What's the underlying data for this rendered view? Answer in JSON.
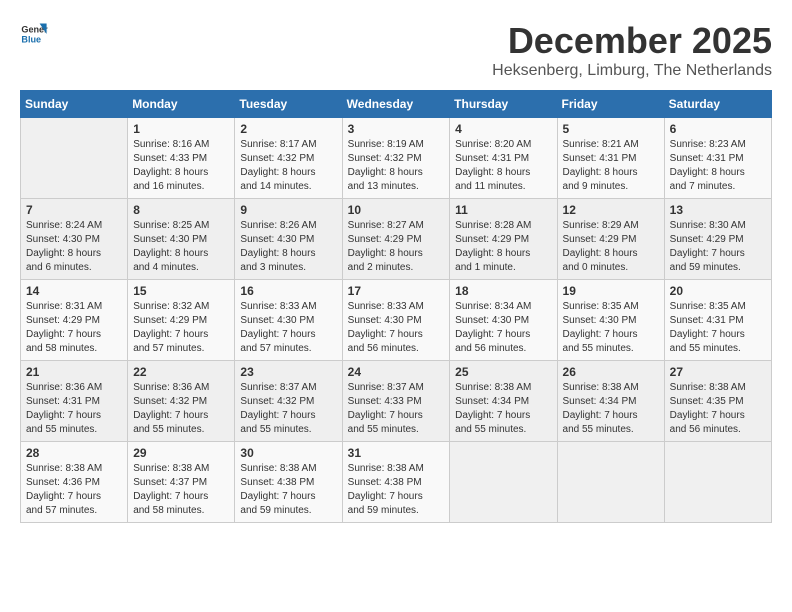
{
  "logo": {
    "line1": "General",
    "line2": "Blue"
  },
  "title": "December 2025",
  "location": "Heksenberg, Limburg, The Netherlands",
  "headers": [
    "Sunday",
    "Monday",
    "Tuesday",
    "Wednesday",
    "Thursday",
    "Friday",
    "Saturday"
  ],
  "weeks": [
    [
      {
        "day": "",
        "info": ""
      },
      {
        "day": "1",
        "info": "Sunrise: 8:16 AM\nSunset: 4:33 PM\nDaylight: 8 hours\nand 16 minutes."
      },
      {
        "day": "2",
        "info": "Sunrise: 8:17 AM\nSunset: 4:32 PM\nDaylight: 8 hours\nand 14 minutes."
      },
      {
        "day": "3",
        "info": "Sunrise: 8:19 AM\nSunset: 4:32 PM\nDaylight: 8 hours\nand 13 minutes."
      },
      {
        "day": "4",
        "info": "Sunrise: 8:20 AM\nSunset: 4:31 PM\nDaylight: 8 hours\nand 11 minutes."
      },
      {
        "day": "5",
        "info": "Sunrise: 8:21 AM\nSunset: 4:31 PM\nDaylight: 8 hours\nand 9 minutes."
      },
      {
        "day": "6",
        "info": "Sunrise: 8:23 AM\nSunset: 4:31 PM\nDaylight: 8 hours\nand 7 minutes."
      }
    ],
    [
      {
        "day": "7",
        "info": "Sunrise: 8:24 AM\nSunset: 4:30 PM\nDaylight: 8 hours\nand 6 minutes."
      },
      {
        "day": "8",
        "info": "Sunrise: 8:25 AM\nSunset: 4:30 PM\nDaylight: 8 hours\nand 4 minutes."
      },
      {
        "day": "9",
        "info": "Sunrise: 8:26 AM\nSunset: 4:30 PM\nDaylight: 8 hours\nand 3 minutes."
      },
      {
        "day": "10",
        "info": "Sunrise: 8:27 AM\nSunset: 4:29 PM\nDaylight: 8 hours\nand 2 minutes."
      },
      {
        "day": "11",
        "info": "Sunrise: 8:28 AM\nSunset: 4:29 PM\nDaylight: 8 hours\nand 1 minute."
      },
      {
        "day": "12",
        "info": "Sunrise: 8:29 AM\nSunset: 4:29 PM\nDaylight: 8 hours\nand 0 minutes."
      },
      {
        "day": "13",
        "info": "Sunrise: 8:30 AM\nSunset: 4:29 PM\nDaylight: 7 hours\nand 59 minutes."
      }
    ],
    [
      {
        "day": "14",
        "info": "Sunrise: 8:31 AM\nSunset: 4:29 PM\nDaylight: 7 hours\nand 58 minutes."
      },
      {
        "day": "15",
        "info": "Sunrise: 8:32 AM\nSunset: 4:29 PM\nDaylight: 7 hours\nand 57 minutes."
      },
      {
        "day": "16",
        "info": "Sunrise: 8:33 AM\nSunset: 4:30 PM\nDaylight: 7 hours\nand 57 minutes."
      },
      {
        "day": "17",
        "info": "Sunrise: 8:33 AM\nSunset: 4:30 PM\nDaylight: 7 hours\nand 56 minutes."
      },
      {
        "day": "18",
        "info": "Sunrise: 8:34 AM\nSunset: 4:30 PM\nDaylight: 7 hours\nand 56 minutes."
      },
      {
        "day": "19",
        "info": "Sunrise: 8:35 AM\nSunset: 4:30 PM\nDaylight: 7 hours\nand 55 minutes."
      },
      {
        "day": "20",
        "info": "Sunrise: 8:35 AM\nSunset: 4:31 PM\nDaylight: 7 hours\nand 55 minutes."
      }
    ],
    [
      {
        "day": "21",
        "info": "Sunrise: 8:36 AM\nSunset: 4:31 PM\nDaylight: 7 hours\nand 55 minutes."
      },
      {
        "day": "22",
        "info": "Sunrise: 8:36 AM\nSunset: 4:32 PM\nDaylight: 7 hours\nand 55 minutes."
      },
      {
        "day": "23",
        "info": "Sunrise: 8:37 AM\nSunset: 4:32 PM\nDaylight: 7 hours\nand 55 minutes."
      },
      {
        "day": "24",
        "info": "Sunrise: 8:37 AM\nSunset: 4:33 PM\nDaylight: 7 hours\nand 55 minutes."
      },
      {
        "day": "25",
        "info": "Sunrise: 8:38 AM\nSunset: 4:34 PM\nDaylight: 7 hours\nand 55 minutes."
      },
      {
        "day": "26",
        "info": "Sunrise: 8:38 AM\nSunset: 4:34 PM\nDaylight: 7 hours\nand 55 minutes."
      },
      {
        "day": "27",
        "info": "Sunrise: 8:38 AM\nSunset: 4:35 PM\nDaylight: 7 hours\nand 56 minutes."
      }
    ],
    [
      {
        "day": "28",
        "info": "Sunrise: 8:38 AM\nSunset: 4:36 PM\nDaylight: 7 hours\nand 57 minutes."
      },
      {
        "day": "29",
        "info": "Sunrise: 8:38 AM\nSunset: 4:37 PM\nDaylight: 7 hours\nand 58 minutes."
      },
      {
        "day": "30",
        "info": "Sunrise: 8:38 AM\nSunset: 4:38 PM\nDaylight: 7 hours\nand 59 minutes."
      },
      {
        "day": "31",
        "info": "Sunrise: 8:38 AM\nSunset: 4:38 PM\nDaylight: 7 hours\nand 59 minutes."
      },
      {
        "day": "",
        "info": ""
      },
      {
        "day": "",
        "info": ""
      },
      {
        "day": "",
        "info": ""
      }
    ]
  ]
}
